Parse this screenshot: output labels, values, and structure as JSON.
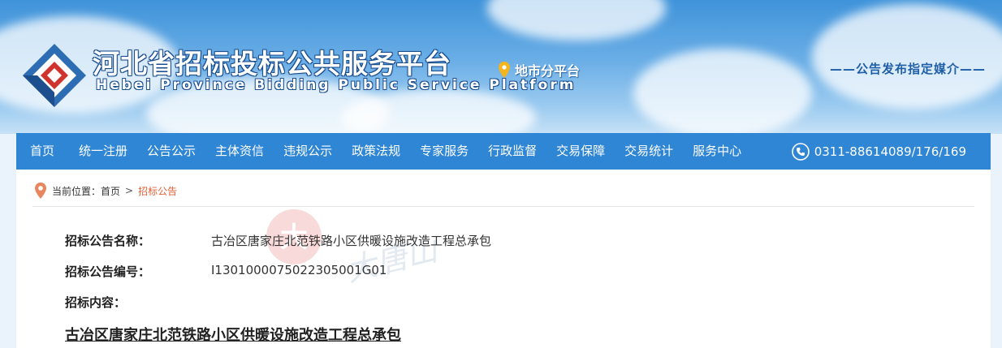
{
  "header": {
    "title": "河北省招标投标公共服务平台",
    "subtitle": "Hebei Province Bidding Public Service Platform",
    "city_platform": "地市分平台",
    "slogan": "——公告发布指定媒介——"
  },
  "nav": {
    "items": [
      "首页",
      "统一注册",
      "公告公示",
      "主体资信",
      "违规公示",
      "政策法规",
      "专家服务",
      "行政监督",
      "交易保障",
      "交易统计",
      "服务中心"
    ],
    "phone": "0311-88614089/176/169"
  },
  "breadcrumb": {
    "prefix": "当前位置：",
    "home": "首页",
    "separator": ">",
    "current": "招标公告"
  },
  "notice": {
    "name_label": "招标公告名称：",
    "name_value": "古冶区唐家庄北范铁路小区供暖设施改造工程总承包",
    "number_label": "招标公告编号：",
    "number_value": "I1301000075022305001G01",
    "content_label": "招标内容：",
    "project_title": "古冶区唐家庄北范铁路小区供暖设施改造工程总承包"
  },
  "watermark": {
    "badge": "大",
    "text": "大唐山"
  },
  "icons": {
    "logo": "hebei-logo-icon",
    "pin": "location-pin-icon",
    "phone": "phone-icon",
    "breadcrumb_pin": "location-pin-icon"
  },
  "colors": {
    "nav_bg": "#2f86d4",
    "accent": "#e0623a",
    "pin": "#f3b41c",
    "brand_dark": "#1f5fa8"
  }
}
